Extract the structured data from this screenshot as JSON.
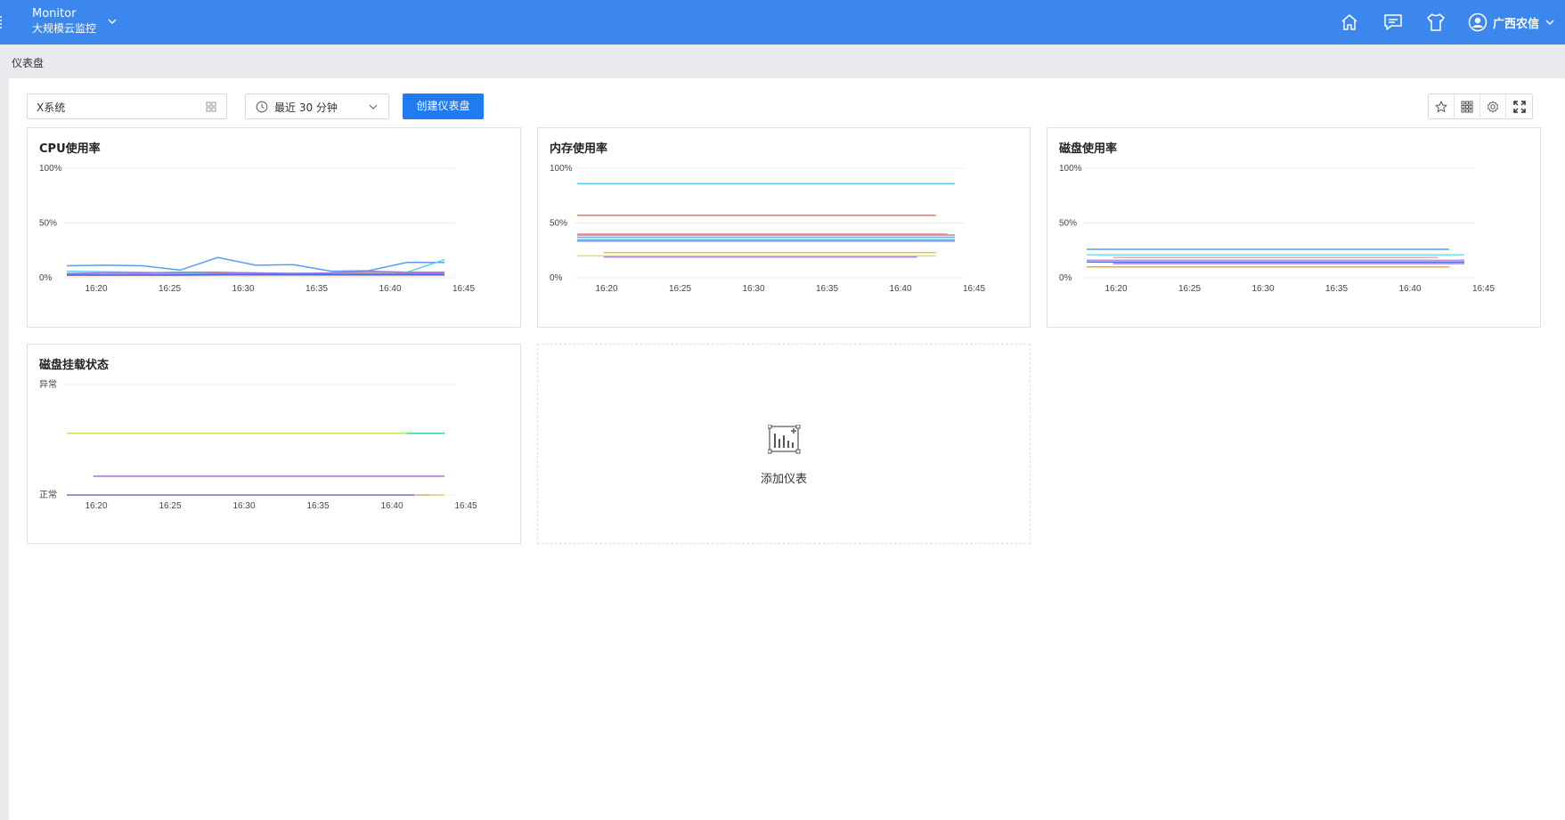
{
  "header": {
    "app_name": "Monitor",
    "app_subtitle": "大规模云监控",
    "user_name": "广西农信"
  },
  "breadcrumb": "仪表盘",
  "toolbar": {
    "system_select": "X系统",
    "time_select": "最近 30 分钟",
    "create_button": "创建仪表盘"
  },
  "chart_data": [
    {
      "type": "line",
      "title": "CPU使用率",
      "x": [
        "16:20",
        "16:25",
        "16:30",
        "16:35",
        "16:40",
        "16:45"
      ],
      "y_ticks": [
        "100%",
        "50%",
        "0%"
      ],
      "ylim": [
        0,
        100
      ],
      "series": [
        {
          "color": "#5b9bf0",
          "values": [
            11,
            11.5,
            11,
            7,
            18.5,
            11.5,
            12,
            6,
            6.5,
            14,
            14
          ]
        },
        {
          "color": "#56d1ea",
          "values": [
            6,
            5.5,
            5,
            4,
            4,
            4.5,
            4,
            4,
            5,
            5,
            16.5
          ]
        },
        {
          "color": "#f08a8a",
          "values": [
            3,
            3,
            3,
            3,
            4,
            4,
            4,
            4,
            4,
            4,
            4
          ]
        },
        {
          "color": "#9a7be0",
          "values": [
            4,
            4.5,
            4.5,
            5,
            5,
            4.5,
            4,
            4.5,
            6,
            5,
            5
          ]
        },
        {
          "color": "#f4a14a",
          "values": [
            2,
            2,
            2,
            2,
            2,
            2,
            2,
            2,
            2,
            2,
            2
          ]
        },
        {
          "color": "#c07be0",
          "values": [
            3,
            3,
            3.5,
            3,
            3,
            3,
            3.5,
            3,
            3,
            4,
            4
          ]
        },
        {
          "color": "#4a6ee0",
          "values": [
            2.5,
            2.5,
            2.5,
            2.5,
            3,
            3,
            3,
            3,
            3,
            3,
            3
          ]
        }
      ]
    },
    {
      "type": "line",
      "title": "内存使用率",
      "x": [
        "16:20",
        "16:25",
        "16:30",
        "16:35",
        "16:40",
        "16:45"
      ],
      "y_ticks": [
        "100%",
        "50%",
        "0%"
      ],
      "ylim": [
        0,
        100
      ],
      "series": [
        {
          "color": "#56d1ea",
          "values": [
            86,
            86
          ]
        },
        {
          "color": "#f07070",
          "values": [
            57,
            57
          ]
        },
        {
          "color": "#f0a0a0",
          "values": [
            40,
            40
          ]
        },
        {
          "color": "#b09090",
          "values": [
            39,
            39
          ]
        },
        {
          "color": "#7f9fe6",
          "values": [
            37,
            37
          ]
        },
        {
          "color": "#8ad0e0",
          "values": [
            35,
            35
          ]
        },
        {
          "color": "#5b9bf0",
          "values": [
            34,
            34
          ]
        },
        {
          "color": "#b0c8f0",
          "values": [
            33,
            33
          ]
        },
        {
          "color": "#d8e060",
          "values": [
            20,
            20
          ]
        },
        {
          "color": "#a982e0",
          "values": [
            19,
            19
          ]
        },
        {
          "color": "#e8c050",
          "values": [
            23,
            23
          ]
        }
      ]
    },
    {
      "type": "line",
      "title": "磁盘使用率",
      "x": [
        "16:20",
        "16:25",
        "16:30",
        "16:35",
        "16:40",
        "16:45"
      ],
      "y_ticks": [
        "100%",
        "50%",
        "0%"
      ],
      "ylim": [
        0,
        100
      ],
      "series": [
        {
          "color": "#5b9bf0",
          "values": [
            26,
            26
          ]
        },
        {
          "color": "#7fd8f0",
          "values": [
            21,
            21
          ]
        },
        {
          "color": "#f0a0a0",
          "values": [
            18.5,
            18.5
          ]
        },
        {
          "color": "#c090e0",
          "values": [
            16,
            16
          ]
        },
        {
          "color": "#4a6ee0",
          "values": [
            14.5,
            14.5
          ]
        },
        {
          "color": "#9a7be0",
          "values": [
            13,
            13
          ]
        },
        {
          "color": "#f4a14a",
          "values": [
            10,
            10
          ]
        }
      ]
    },
    {
      "type": "line",
      "title": "磁盘挂载状态",
      "x": [
        "16:20",
        "16:25",
        "16:30",
        "16:35",
        "16:40",
        "16:45"
      ],
      "y_ticks": [
        "异常",
        "正常"
      ],
      "ylim": [
        0,
        1
      ],
      "series": [
        {
          "color": "#b8e060",
          "values": [
            0.56,
            0.56
          ]
        },
        {
          "color": "#40d0a0",
          "values": [
            0.56,
            0.56
          ]
        },
        {
          "color": "#b070e0",
          "values": [
            0.17,
            0.17
          ]
        },
        {
          "color": "#8a60d0",
          "values": [
            0.0,
            0.0
          ]
        },
        {
          "color": "#f4c070",
          "values": [
            0.0,
            0.0
          ]
        }
      ]
    }
  ],
  "add_widget_label": "添加仪表"
}
